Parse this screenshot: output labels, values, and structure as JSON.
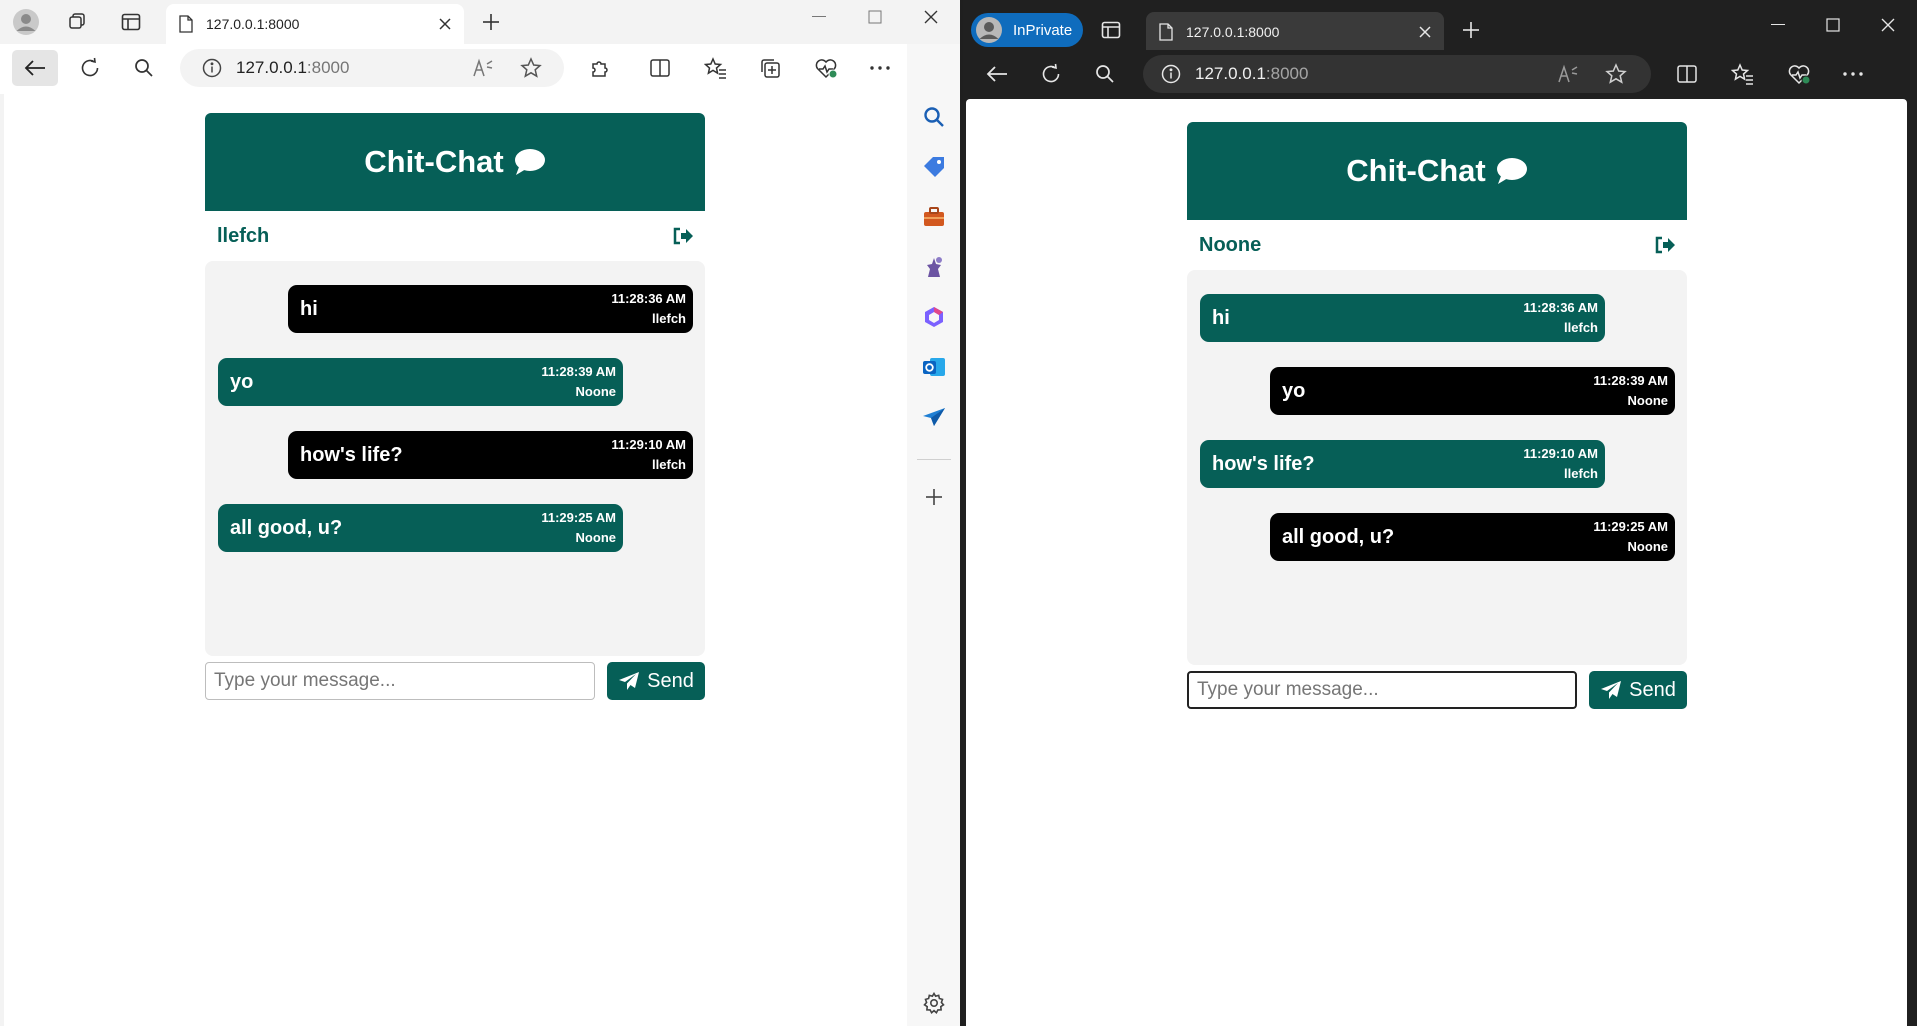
{
  "left": {
    "tab": {
      "title": "127.0.0.1:8000"
    },
    "address": {
      "host": "127.0.0.1",
      "port": ":8000"
    },
    "app": {
      "title": "Chit-Chat",
      "username": "llefch",
      "messages": [
        {
          "text": "hi",
          "time": "11:28:36 AM",
          "sender": "llefch",
          "style": "black"
        },
        {
          "text": "yo",
          "time": "11:28:39 AM",
          "sender": "Noone",
          "style": "green"
        },
        {
          "text": "how's life?",
          "time": "11:29:10 AM",
          "sender": "llefch",
          "style": "black"
        },
        {
          "text": "all good, u?",
          "time": "11:29:25 AM",
          "sender": "Noone",
          "style": "green"
        }
      ],
      "input_placeholder": "Type your message...",
      "send_label": "Send"
    }
  },
  "right": {
    "inprivate_label": "InPrivate",
    "tab": {
      "title": "127.0.0.1:8000"
    },
    "address": {
      "host": "127.0.0.1",
      "port": ":8000"
    },
    "app": {
      "title": "Chit-Chat",
      "username": "Noone",
      "messages": [
        {
          "text": "hi",
          "time": "11:28:36 AM",
          "sender": "llefch",
          "style": "green"
        },
        {
          "text": "yo",
          "time": "11:28:39 AM",
          "sender": "Noone",
          "style": "black"
        },
        {
          "text": "how's life?",
          "time": "11:29:10 AM",
          "sender": "llefch",
          "style": "green"
        },
        {
          "text": "all good, u?",
          "time": "11:29:25 AM",
          "sender": "Noone",
          "style": "black"
        }
      ],
      "input_placeholder": "Type your message...",
      "send_label": "Send"
    }
  },
  "colors": {
    "brand": "#065f57",
    "own_bubble": "#000000",
    "other_bubble": "#065f57"
  }
}
